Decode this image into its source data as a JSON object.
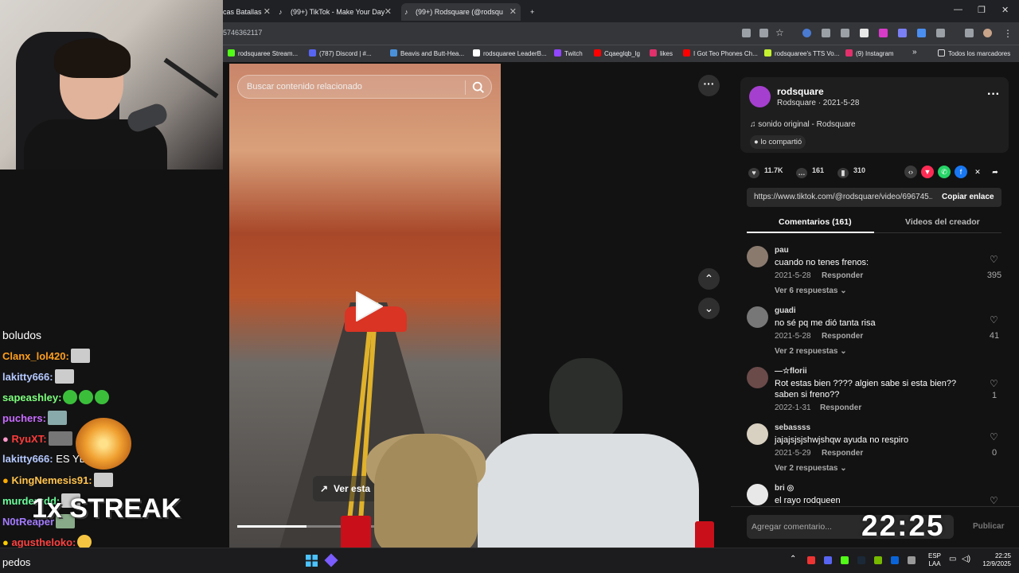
{
  "browser": {
    "tabs": [
      {
        "title": "cas Batallas"
      },
      {
        "title": "(99+) TikTok - Make Your Day"
      },
      {
        "title": "(99+) Rodsquare (@rodsqu"
      }
    ],
    "new_tab_symbol": "+",
    "url": "5746362117",
    "bookmarks": [
      {
        "label": "rodsquaree Stream...",
        "color": "#53fc18"
      },
      {
        "label": "(787) Discord | #...",
        "color": "#5865f2"
      },
      {
        "label": "Beavis and Butt-Hea...",
        "color": "#4a90d9"
      },
      {
        "label": "rodsquaree LeaderB...",
        "color": "#ffffff"
      },
      {
        "label": "Twitch",
        "color": "#9146ff"
      },
      {
        "label": "Cqaeglqb_lg",
        "color": "#ff0000"
      },
      {
        "label": "likes",
        "color": "#e1306c"
      },
      {
        "label": "I Got Teo Phones Ch...",
        "color": "#ff0000"
      },
      {
        "label": "rodsquaree's TTS Vo...",
        "color": "#c5f230"
      },
      {
        "label": "(9) Instagram",
        "color": "#e1306c"
      }
    ],
    "bookmarks_overflow": "»",
    "all_bookmarks": "Todos los marcadores"
  },
  "chat": {
    "lines": [
      {
        "user": "boludos",
        "color": "#ffffff",
        "msg": ""
      },
      {
        "user": "Clanx_lol420:",
        "color": "#ff9f1c",
        "msg": ""
      },
      {
        "user": "lakitty666:",
        "color": "#b4c8ff",
        "msg": ""
      },
      {
        "user": "sapeashley:",
        "color": "#7dff7d",
        "msg": ""
      },
      {
        "user": "puchers:",
        "color": "#c86bff",
        "msg": ""
      },
      {
        "user": "RyuXT:",
        "color": "#ff3b3b",
        "msg": ""
      },
      {
        "user": "lakitty666:",
        "color": "#b4c8ff",
        "msg": "ES        YBOY"
      },
      {
        "user": "KingNemesis91:",
        "color": "#ffc24d",
        "msg": ""
      },
      {
        "user": "murderxdd:",
        "color": "#6bff9c",
        "msg": ""
      },
      {
        "user": "N0tReaper",
        "color": "#a37bff",
        "msg": ""
      },
      {
        "user": "agustheloko:",
        "color": "#ff4040",
        "msg": ""
      }
    ],
    "streak": "1x STREAK",
    "bottom_text": "pedos"
  },
  "video": {
    "search_placeholder": "Buscar contenido relacionado",
    "ver_button": "Ver esta",
    "progress": 0.29
  },
  "post": {
    "username": "rodsquare",
    "subline": "Rodsquare · 2021-5-28",
    "sound": "sonido original - Rodsquare",
    "shared": "lo compartió",
    "likes": "11.7K",
    "comments": "161",
    "saves": "310",
    "link": "https://www.tiktok.com/@rodsquare/video/696745...",
    "copy_label": "Copiar enlace",
    "tab_comments": "Comentarios (161)",
    "tab_videos": "Videos del creador"
  },
  "comments": [
    {
      "name": "pau",
      "text": "cuando no tenes frenos:",
      "date": "2021-5-28",
      "reply": "Responder",
      "replies": "Ver 6 respuestas ⌄",
      "likes": "395",
      "avatar": "#8a7a6e"
    },
    {
      "name": "guadi",
      "text": "no sé pq me dió tanta risa",
      "date": "2021-5-28",
      "reply": "Responder",
      "replies": "Ver 2 respuestas ⌄",
      "likes": "41",
      "avatar": "#777"
    },
    {
      "name": "—☆florii",
      "text": "Rot estas bien ???? algien sabe si esta bien?? saben si freno??",
      "date": "2022-1-31",
      "reply": "Responder",
      "replies": "",
      "likes": "1",
      "avatar": "#6b4a4a"
    },
    {
      "name": "sebassss",
      "text": "jajajsjsjshwjshqw ayuda no respiro",
      "date": "2021-5-29",
      "reply": "Responder",
      "replies": "Ver 2 respuestas ⌄",
      "likes": "0",
      "avatar": "#d8d0c0"
    },
    {
      "name": "bri ◎",
      "text": "el rayo rodqueen",
      "date": "",
      "reply": "",
      "replies": "",
      "likes": "",
      "avatar": "#e8e8e8"
    }
  ],
  "comment_input": {
    "placeholder": "Agregar comentario...",
    "publish": "Publicar"
  },
  "overlay_clock": "22:25",
  "taskbar": {
    "lang_top": "ESP",
    "lang_bottom": "LAA",
    "time": "22:25",
    "date": "12/9/2025"
  },
  "colors": {
    "accent_red": "#fe2c55",
    "panel_bg": "#121212"
  }
}
